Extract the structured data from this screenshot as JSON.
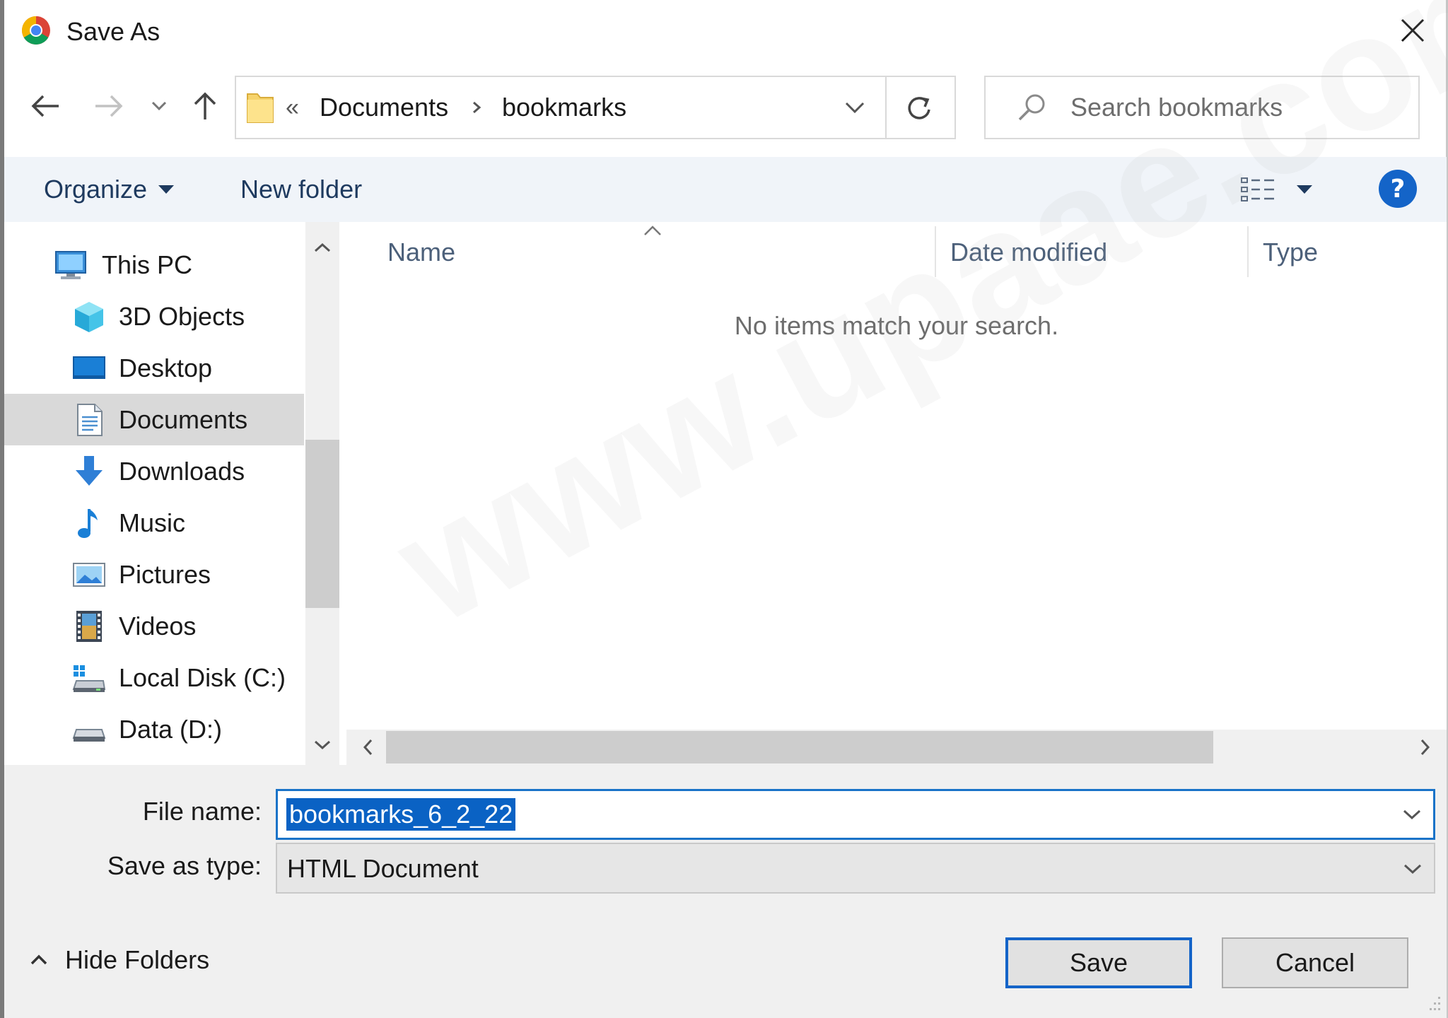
{
  "window": {
    "title": "Save As"
  },
  "address_bar": {
    "overflow": "«",
    "segments": [
      "Documents",
      "bookmarks"
    ]
  },
  "search": {
    "placeholder": "Search bookmarks"
  },
  "toolbar": {
    "organize": "Organize",
    "new_folder": "New folder",
    "help": "?"
  },
  "nav_tree": {
    "items": [
      {
        "label": "This PC",
        "icon": "computer-icon"
      },
      {
        "label": "3D Objects",
        "icon": "3d-objects-icon"
      },
      {
        "label": "Desktop",
        "icon": "desktop-icon"
      },
      {
        "label": "Documents",
        "icon": "documents-icon",
        "selected": true
      },
      {
        "label": "Downloads",
        "icon": "downloads-icon"
      },
      {
        "label": "Music",
        "icon": "music-icon"
      },
      {
        "label": "Pictures",
        "icon": "pictures-icon"
      },
      {
        "label": "Videos",
        "icon": "videos-icon"
      },
      {
        "label": "Local Disk (C:)",
        "icon": "local-disk-icon"
      },
      {
        "label": "Data (D:)",
        "icon": "drive-icon"
      }
    ]
  },
  "file_list": {
    "columns": [
      "Name",
      "Date modified",
      "Type"
    ],
    "empty_message": "No items match your search."
  },
  "form": {
    "file_name_label": "File name:",
    "file_name_value": "bookmarks_6_2_22",
    "save_type_label": "Save as type:",
    "save_type_value": "HTML Document"
  },
  "footer": {
    "hide_folders": "Hide Folders",
    "save": "Save",
    "cancel": "Cancel"
  },
  "watermark": "www.upaae.com",
  "colors": {
    "accent": "#1464c8",
    "selection": "#0a62c4",
    "toolbar_bg": "#f0f4f9",
    "panel_bg": "#f0f0f0"
  }
}
